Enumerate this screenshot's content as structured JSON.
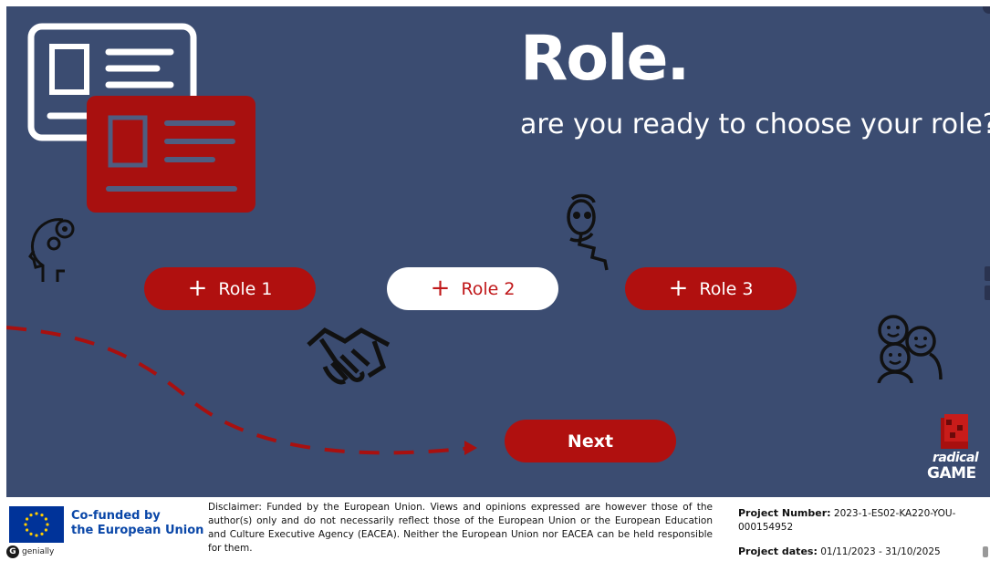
{
  "slide": {
    "title": "Role.",
    "subtitle": "are you ready to choose your role?",
    "roles": [
      {
        "plus": "+",
        "label": "Role 1",
        "state": "default"
      },
      {
        "plus": "+",
        "label": "Role 2",
        "state": "selected"
      },
      {
        "plus": "+",
        "label": "Role 3",
        "state": "default"
      }
    ],
    "next_label": "Next",
    "logo": {
      "line1": "radical",
      "line2": "GAME"
    },
    "icons": [
      "id-card-icon",
      "id-card-red-icon",
      "head-gears-icon",
      "thinking-character-icon",
      "handshake-icon",
      "group-people-icon",
      "dashed-arrow-icon"
    ]
  },
  "footer": {
    "eu_line1": "Co-funded by",
    "eu_line2": "the European Union",
    "genially": "genially",
    "disclaimer": "Disclaimer: Funded by the European Union. Views and opinions expressed are however those of the author(s) only and do not necessarily reflect those of the European Union or the European Education and Culture Executive Agency (EACEA). Neither the European Union nor EACEA can be held responsible for them.",
    "project_number_label": "Project Number:",
    "project_number": "2023-1-ES02-KA220-YOU-000154952",
    "project_dates_label": "Project dates:",
    "project_dates": "01/11/2023 - 31/10/2025"
  },
  "colors": {
    "background": "#3b4c71",
    "accent_red": "#b0100f",
    "white": "#ffffff",
    "eu_blue": "#003399",
    "eu_text": "#0a47a8"
  }
}
